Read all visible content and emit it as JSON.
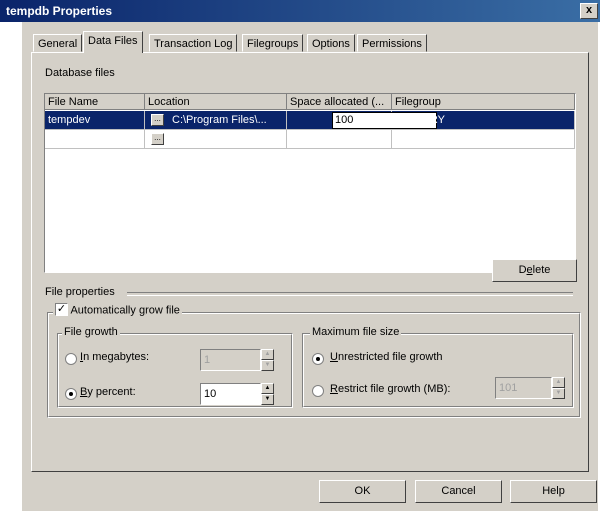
{
  "window": {
    "title": "tempdb Properties",
    "close_glyph": "x"
  },
  "tabs": [
    {
      "label": "General"
    },
    {
      "label": "Data Files",
      "active": true
    },
    {
      "label": "Transaction Log"
    },
    {
      "label": "Filegroups"
    },
    {
      "label": "Options"
    },
    {
      "label": "Permissions"
    }
  ],
  "database_files": {
    "section_label": "Database files",
    "columns": [
      "File Name",
      "Location",
      "Space allocated (...",
      "Filegroup"
    ],
    "rows": [
      {
        "file_name": "tempdev",
        "location": "C:\\Program Files\\...",
        "space_allocated": "100",
        "filegroup": "PRIMARY",
        "selected": true
      },
      {
        "file_name": "",
        "location": "",
        "space_allocated": "",
        "filegroup": "",
        "selected": false
      }
    ],
    "browse_glyph": "..."
  },
  "delete_button": {
    "label_pre": "D",
    "label_ul": "e",
    "label_post": "lete"
  },
  "file_properties": {
    "section_label": "File properties",
    "auto_grow": {
      "label_pre": "Automatically ",
      "label_ul": "g",
      "label_post": "row file",
      "checked": true
    },
    "file_growth": {
      "title": "File growth",
      "megabytes": {
        "label_ul": "I",
        "label_post": "n megabytes:",
        "value": "1",
        "selected": false
      },
      "percent": {
        "label_ul": "B",
        "label_post": "y percent:",
        "value": "10",
        "selected": true
      }
    },
    "max_file_size": {
      "title": "Maximum file size",
      "unrestricted": {
        "label_ul": "U",
        "label_post": "nrestricted file growth",
        "selected": true
      },
      "restrict": {
        "label_ul": "R",
        "label_post": "estrict file growth (MB):",
        "value": "101",
        "selected": false
      }
    }
  },
  "footer": {
    "ok": "OK",
    "cancel": "Cancel",
    "help": "Help"
  }
}
